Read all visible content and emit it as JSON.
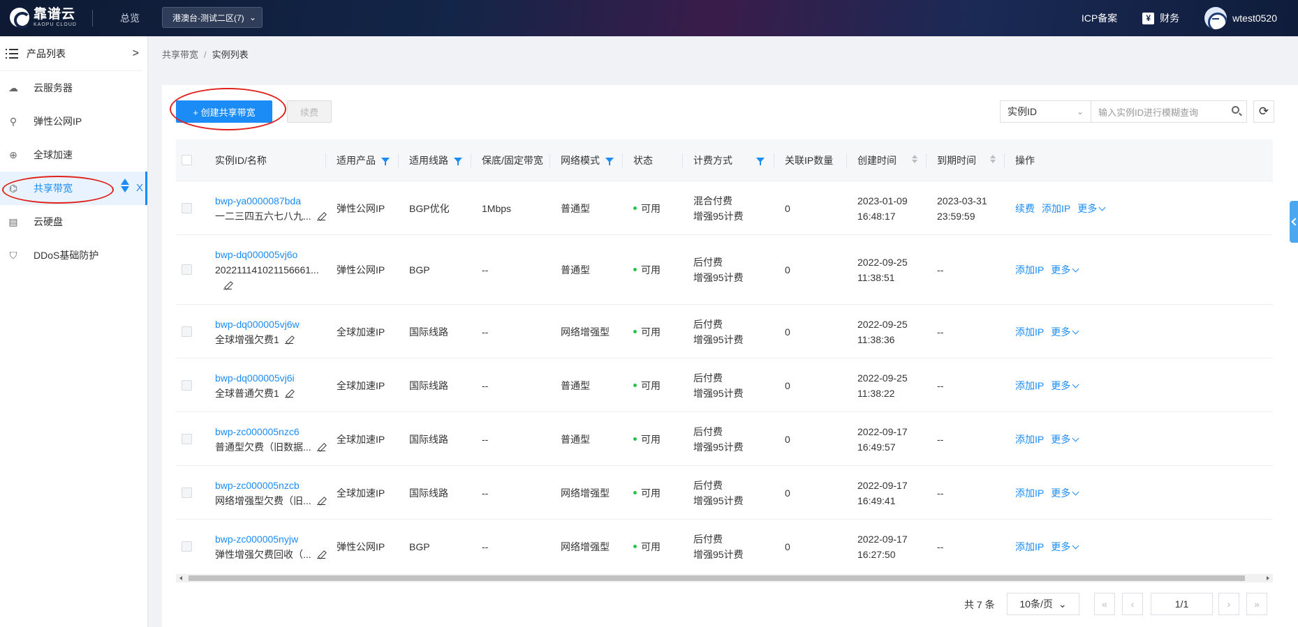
{
  "header": {
    "logo_cn": "靠谱云",
    "logo_en": "KAOPU CLOUD",
    "overview": "总览",
    "region": "港澳台-测试二区(7)",
    "icp": "ICP备案",
    "finance": "财务",
    "username": "wtest0520"
  },
  "sidebar": {
    "title": "产品列表",
    "items": [
      {
        "label": "云服务器",
        "icon": "cloud-server-icon"
      },
      {
        "label": "弹性公网IP",
        "icon": "link-icon"
      },
      {
        "label": "全球加速",
        "icon": "globe-icon"
      },
      {
        "label": "共享带宽",
        "icon": "network-icon"
      },
      {
        "label": "云硬盘",
        "icon": "disk-icon"
      },
      {
        "label": "DDoS基础防护",
        "icon": "shield-icon"
      }
    ],
    "active_index": 3
  },
  "breadcrumb": {
    "parent": "共享带宽",
    "current": "实例列表"
  },
  "toolbar": {
    "create": "+ 创建共享带宽",
    "renew": "续费",
    "search_field": "实例ID",
    "search_placeholder": "输入实例ID进行模糊查询"
  },
  "table": {
    "headers": [
      "实例ID/名称",
      "适用产品",
      "适用线路",
      "保底/固定带宽",
      "网络模式",
      "状态",
      "计费方式",
      "关联IP数量",
      "创建时间",
      "到期时间",
      "操作"
    ],
    "rows": [
      {
        "id": "bwp-ya0000087bda",
        "name": "一二三四五六七八九...",
        "product": "弹性公网IP",
        "line": "BGP优化",
        "bw": "1Mbps",
        "mode": "普通型",
        "status": "可用",
        "billing1": "混合付费",
        "billing2": "增强95计费",
        "ips": "0",
        "created1": "2023-01-09",
        "created2": "16:48:17",
        "expire1": "2023-03-31",
        "expire2": "23:59:59",
        "ops": [
          "续费",
          "添加IP",
          "更多"
        ]
      },
      {
        "id": "bwp-dq000005vj6o",
        "name": "202211141021156661...",
        "product": "弹性公网IP",
        "line": "BGP",
        "bw": "--",
        "mode": "普通型",
        "status": "可用",
        "billing1": "后付费",
        "billing2": "增强95计费",
        "ips": "0",
        "created1": "2022-09-25",
        "created2": "11:38:51",
        "expire1": "--",
        "expire2": "",
        "ops": [
          "添加IP",
          "更多"
        ]
      },
      {
        "id": "bwp-dq000005vj6w",
        "name": "全球增强欠费1",
        "product": "全球加速IP",
        "line": "国际线路",
        "bw": "--",
        "mode": "网络增强型",
        "status": "可用",
        "billing1": "后付费",
        "billing2": "增强95计费",
        "ips": "0",
        "created1": "2022-09-25",
        "created2": "11:38:36",
        "expire1": "--",
        "expire2": "",
        "ops": [
          "添加IP",
          "更多"
        ]
      },
      {
        "id": "bwp-dq000005vj6i",
        "name": "全球普通欠费1",
        "product": "全球加速IP",
        "line": "国际线路",
        "bw": "--",
        "mode": "普通型",
        "status": "可用",
        "billing1": "后付费",
        "billing2": "增强95计费",
        "ips": "0",
        "created1": "2022-09-25",
        "created2": "11:38:22",
        "expire1": "--",
        "expire2": "",
        "ops": [
          "添加IP",
          "更多"
        ]
      },
      {
        "id": "bwp-zc000005nzc6",
        "name": "普通型欠费（旧数据...",
        "product": "全球加速IP",
        "line": "国际线路",
        "bw": "--",
        "mode": "普通型",
        "status": "可用",
        "billing1": "后付费",
        "billing2": "增强95计费",
        "ips": "0",
        "created1": "2022-09-17",
        "created2": "16:49:57",
        "expire1": "--",
        "expire2": "",
        "ops": [
          "添加IP",
          "更多"
        ]
      },
      {
        "id": "bwp-zc000005nzcb",
        "name": "网络增强型欠费（旧...",
        "product": "全球加速IP",
        "line": "国际线路",
        "bw": "--",
        "mode": "网络增强型",
        "status": "可用",
        "billing1": "后付费",
        "billing2": "增强95计费",
        "ips": "0",
        "created1": "2022-09-17",
        "created2": "16:49:41",
        "expire1": "--",
        "expire2": "",
        "ops": [
          "添加IP",
          "更多"
        ]
      },
      {
        "id": "bwp-zc000005nyjw",
        "name": "弹性增强欠费回收（...",
        "product": "弹性公网IP",
        "line": "BGP",
        "bw": "--",
        "mode": "网络增强型",
        "status": "可用",
        "billing1": "后付费",
        "billing2": "增强95计费",
        "ips": "0",
        "created1": "2022-09-17",
        "created2": "16:27:50",
        "expire1": "--",
        "expire2": "",
        "ops": [
          "添加IP",
          "更多"
        ]
      }
    ]
  },
  "pagination": {
    "total": "共 7 条",
    "page_size": "10条/页",
    "page": "1/1"
  },
  "colors": {
    "accent": "#1b8cf5",
    "annotation": "#e0201a",
    "status_ok": "#27c24c"
  }
}
